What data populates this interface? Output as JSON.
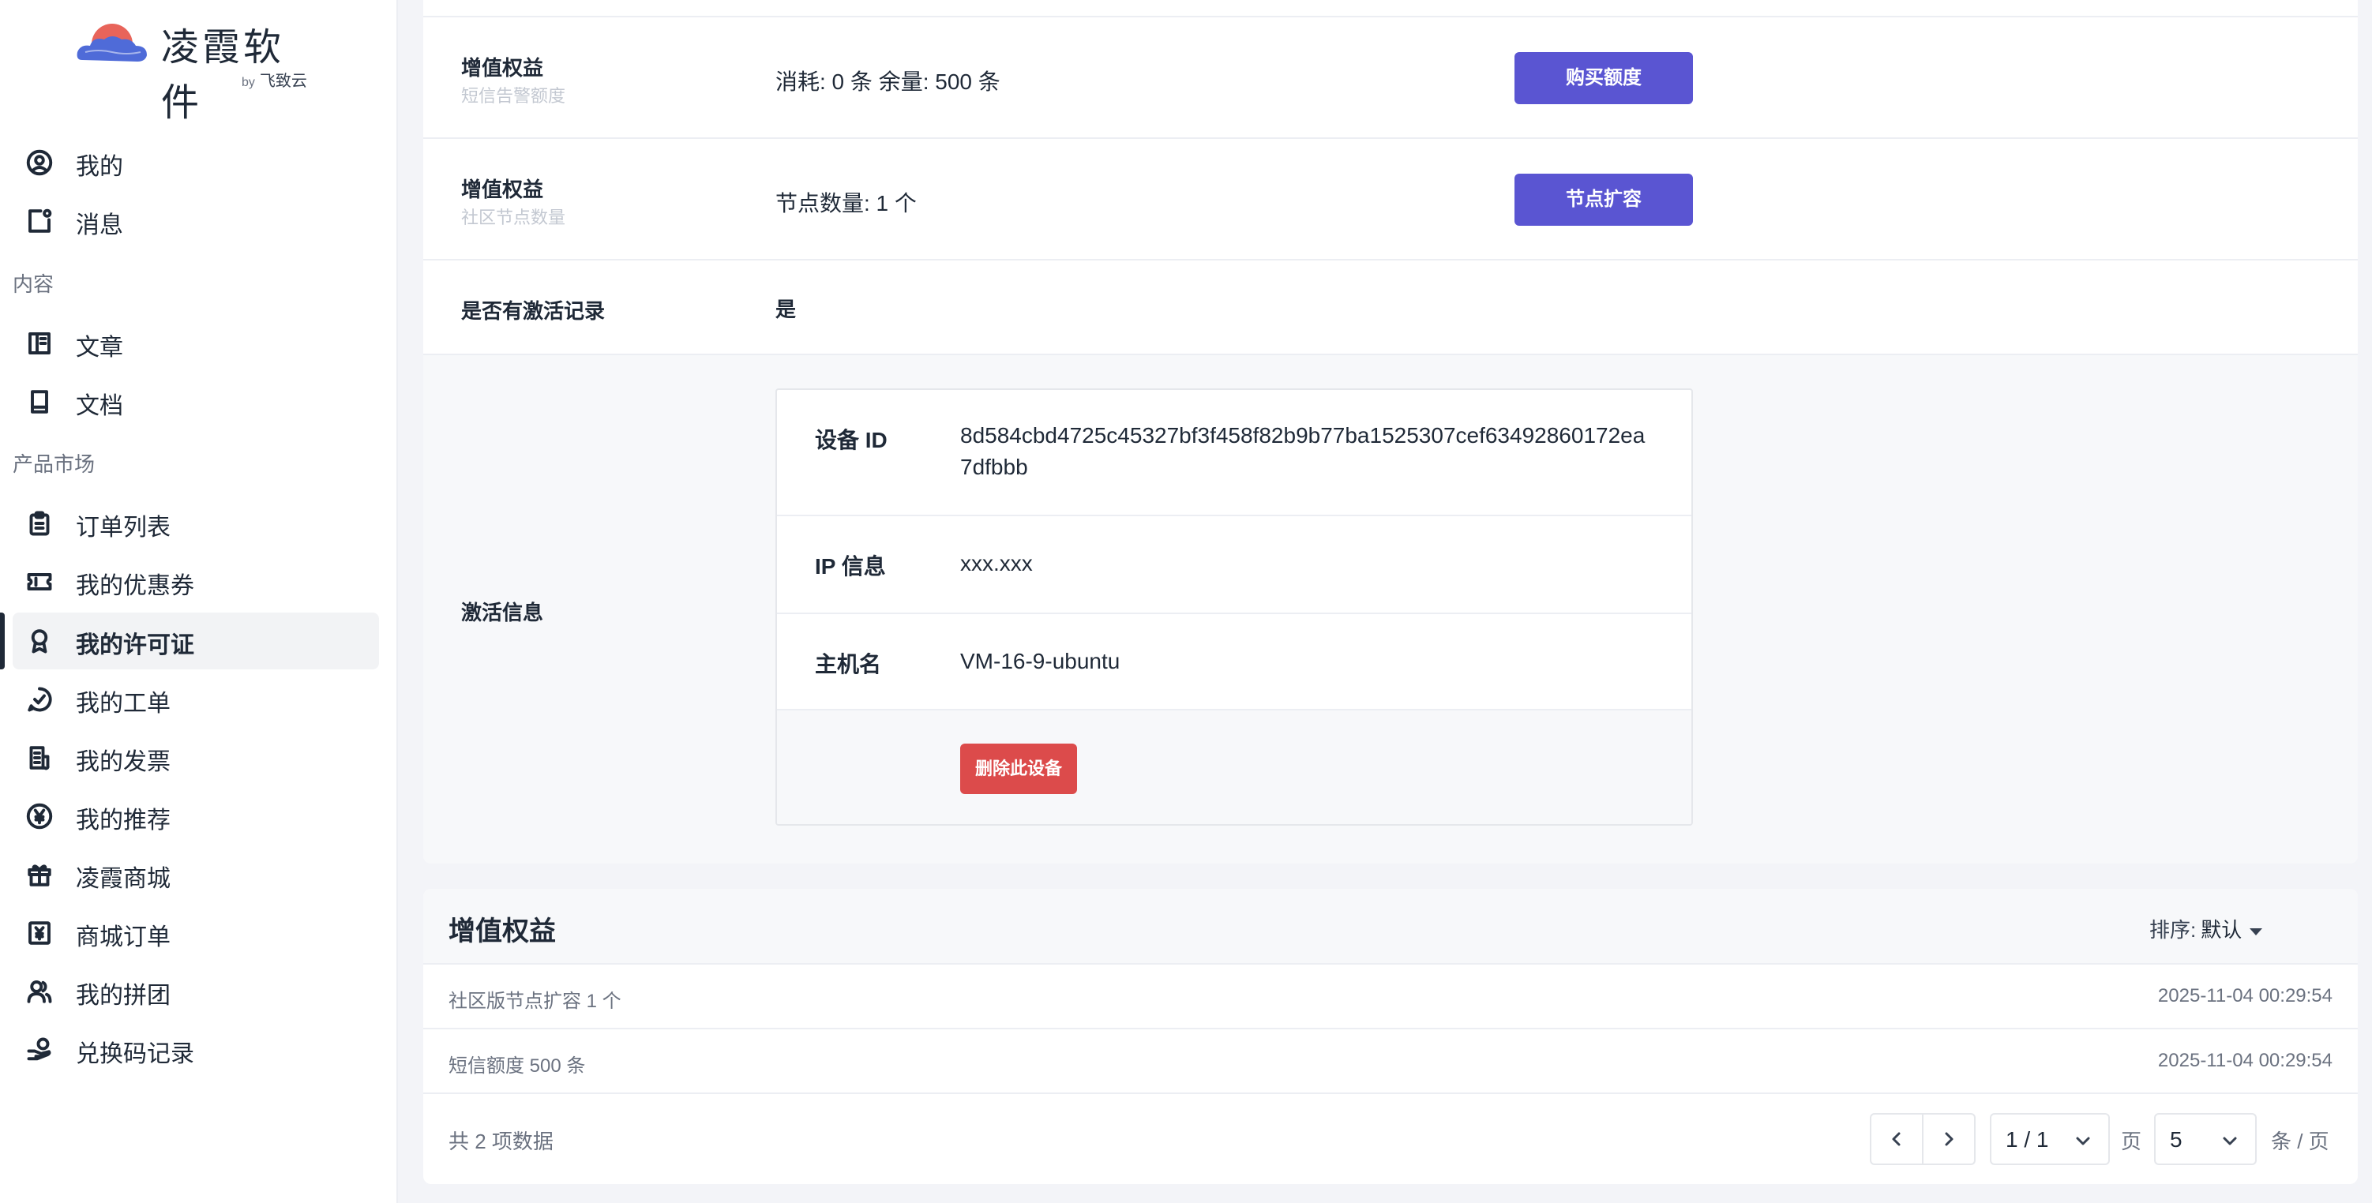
{
  "brand": {
    "name": "凌霞软件",
    "by": "by",
    "sub": "飞致云"
  },
  "sidebar": {
    "items_top": [
      {
        "label": "我的",
        "icon": "user-circle-icon"
      },
      {
        "label": "消息",
        "icon": "message-icon"
      }
    ],
    "section_content": "内容",
    "items_content": [
      {
        "label": "文章",
        "icon": "article-icon"
      },
      {
        "label": "文档",
        "icon": "book-icon"
      }
    ],
    "section_market": "产品市场",
    "items_market": [
      {
        "label": "订单列表",
        "icon": "clipboard-icon"
      },
      {
        "label": "我的优惠券",
        "icon": "ticket-icon"
      },
      {
        "label": "我的许可证",
        "icon": "award-icon",
        "active": true
      },
      {
        "label": "我的工单",
        "icon": "chat-check-icon"
      },
      {
        "label": "我的发票",
        "icon": "receipt-icon"
      },
      {
        "label": "我的推荐",
        "icon": "yen-icon"
      },
      {
        "label": "凌霞商城",
        "icon": "gift-icon"
      },
      {
        "label": "商城订单",
        "icon": "order-icon"
      },
      {
        "label": "我的拼团",
        "icon": "users-icon"
      },
      {
        "label": "兑换码记录",
        "icon": "hand-coin-icon"
      }
    ]
  },
  "license": {
    "sms": {
      "key": "增值权益",
      "sub": "短信告警额度",
      "value": "消耗: 0 条 余量: 500 条",
      "button": "购买额度"
    },
    "nodes": {
      "key": "增值权益",
      "sub": "社区节点数量",
      "value": "节点数量: 1 个",
      "button": "节点扩容"
    },
    "activated": {
      "key": "是否有激活记录",
      "value": "是"
    },
    "activation": {
      "key": "激活信息",
      "device_id_label": "设备 ID",
      "device_id": "8d584cbd4725c45327bf3f458f82b9b77ba1525307cef63492860172ea7dfbbb",
      "ip_label": "IP 信息",
      "ip": "xxx.xxx",
      "host_label": "主机名",
      "host": "VM-16-9-ubuntu",
      "delete_button": "删除此设备"
    }
  },
  "benefits": {
    "title": "增值权益",
    "sort_label": "排序:",
    "sort_value": "默认",
    "rows": [
      {
        "name": "社区版节点扩容 1 个",
        "time": "2025-11-04 00:29:54"
      },
      {
        "name": "短信额度 500 条",
        "time": "2025-11-04 00:29:54"
      }
    ],
    "total": "共 2 项数据",
    "page": "1 / 1",
    "page_unit": "页",
    "page_size": "5",
    "size_unit": "条 / 页"
  },
  "colors": {
    "primary": "#5a55d2",
    "danger": "#dc4b4b",
    "logo_sun": "#e8645a",
    "logo_cloud": "#4f6bd8"
  }
}
